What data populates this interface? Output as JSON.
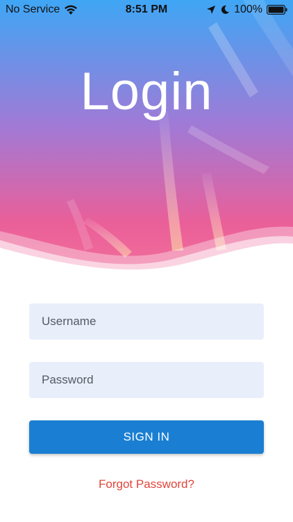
{
  "status_bar": {
    "carrier": "No Service",
    "time": "8:51 PM",
    "battery": "100%"
  },
  "login": {
    "title": "Login",
    "username_placeholder": "Username",
    "password_placeholder": "Password",
    "sign_in_label": "SIGN IN",
    "forgot_password_label": "Forgot Password?"
  },
  "colors": {
    "gradient_top": "#4aa3f0",
    "gradient_middle": "#b46fc7",
    "gradient_bottom": "#ef5b8e",
    "field_background": "#e8effb",
    "button_blue": "#1a7fd3",
    "link_red": "#e0453a"
  },
  "icons": [
    "wifi-icon",
    "location-arrow-icon",
    "moon-icon",
    "battery-icon"
  ]
}
